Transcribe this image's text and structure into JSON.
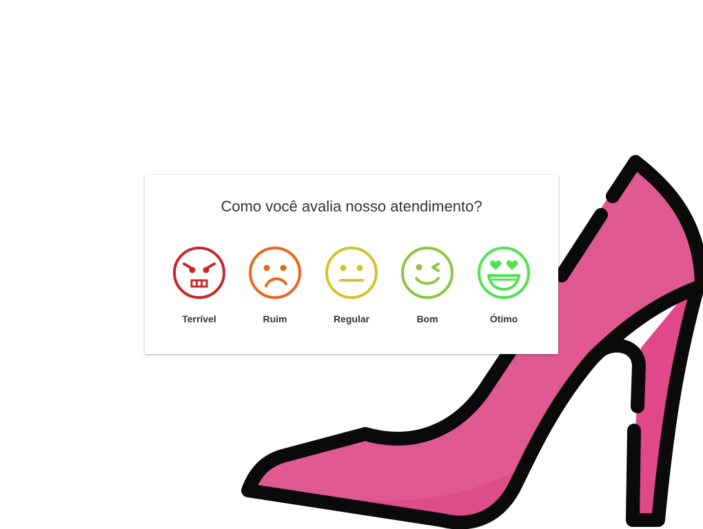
{
  "survey": {
    "question": "Como você avalia nosso atendimento?",
    "options": [
      {
        "label": "Terrível",
        "icon": "angry-face-icon",
        "color": "#c62828"
      },
      {
        "label": "Ruim",
        "icon": "sad-face-icon",
        "color": "#e8671c"
      },
      {
        "label": "Regular",
        "icon": "neutral-face-icon",
        "color": "#d4c227"
      },
      {
        "label": "Bom",
        "icon": "winking-face-icon",
        "color": "#8cc63f"
      },
      {
        "label": "Ótimo",
        "icon": "heart-eyes-face-icon",
        "color": "#4ee44e"
      }
    ]
  },
  "background": {
    "illustration": "high-heel-shoe-icon",
    "shoe_color": "#e05a91",
    "outline_color": "#0a0a0a"
  }
}
